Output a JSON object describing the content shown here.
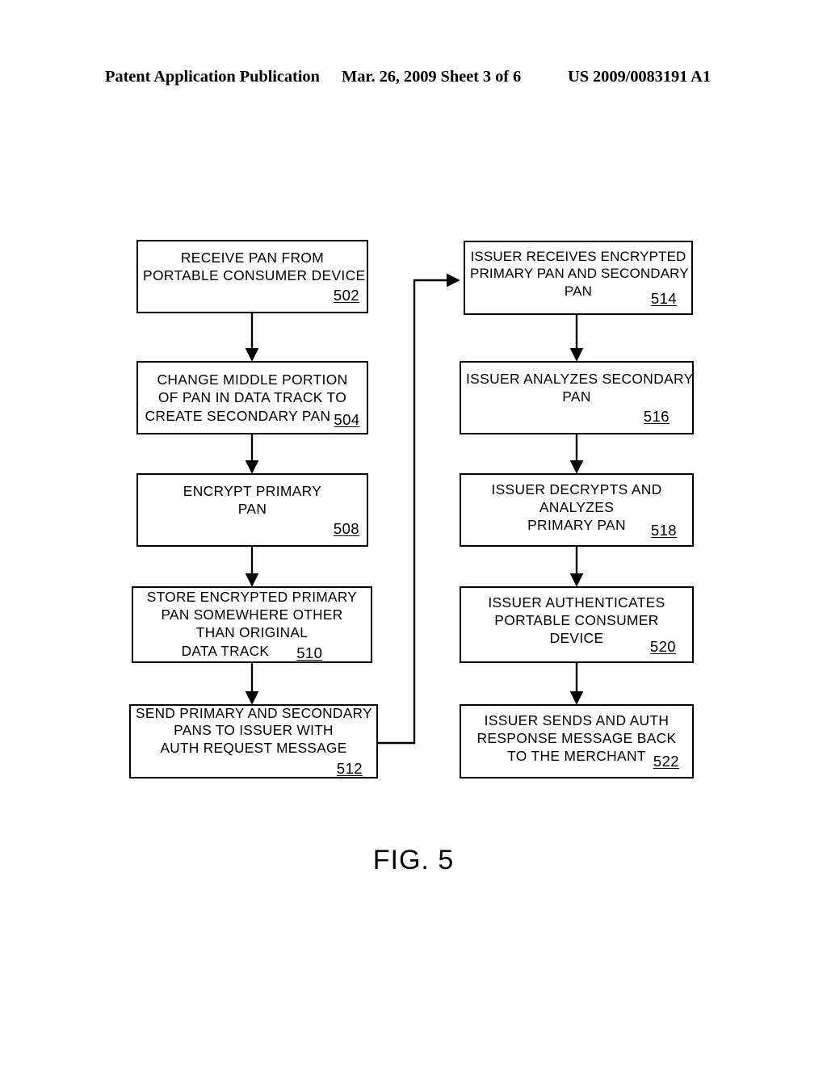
{
  "header": {
    "publication": "Patent Application Publication",
    "date_sheet": "Mar. 26, 2009  Sheet 3 of 6",
    "patent_number": "US 2009/0083191 A1"
  },
  "figure": {
    "caption": "FIG. 5",
    "type": "flowchart"
  },
  "flowchart": {
    "left_column": [
      {
        "ref": "502",
        "ref_placement": "below-right",
        "lines": [
          "RECEIVE PAN FROM",
          "PORTABLE CONSUMER DEVICE"
        ]
      },
      {
        "ref": "504",
        "ref_placement": "inline-end",
        "lines": [
          "CHANGE MIDDLE PORTION",
          "OF PAN IN DATA TRACK TO",
          "CREATE SECONDARY PAN"
        ]
      },
      {
        "ref": "508",
        "ref_placement": "below-right",
        "lines": [
          "ENCRYPT PRIMARY",
          "PAN"
        ]
      },
      {
        "ref": "510",
        "ref_placement": "inline-end",
        "lines": [
          "STORE ENCRYPTED PRIMARY",
          "PAN SOMEWHERE OTHER",
          "THAN ORIGINAL",
          "DATA TRACK"
        ]
      },
      {
        "ref": "512",
        "ref_placement": "below-right",
        "lines": [
          "SEND PRIMARY AND SECONDARY",
          "PANS TO ISSUER WITH",
          "AUTH REQUEST MESSAGE"
        ]
      }
    ],
    "right_column": [
      {
        "ref": "514",
        "ref_placement": "below-right",
        "lines": [
          "ISSUER RECEIVES ENCRYPTED",
          "PRIMARY PAN AND SECONDARY",
          "PAN"
        ]
      },
      {
        "ref": "516",
        "ref_placement": "below-right",
        "lines": [
          "ISSUER ANALYZES SECONDARY",
          "PAN"
        ]
      },
      {
        "ref": "518",
        "ref_placement": "below-right",
        "lines": [
          "ISSUER DECRYPTS AND",
          "ANALYZES",
          "PRIMARY PAN"
        ]
      },
      {
        "ref": "520",
        "ref_placement": "below-right",
        "lines": [
          "ISSUER AUTHENTICATES",
          "PORTABLE CONSUMER",
          "DEVICE"
        ]
      },
      {
        "ref": "522",
        "ref_placement": "below-right",
        "lines": [
          "ISSUER SENDS AND AUTH",
          "RESPONSE MESSAGE BACK",
          "TO THE MERCHANT"
        ]
      }
    ],
    "connectors": [
      {
        "from": "502",
        "to": "504",
        "style": "vertical-arrow"
      },
      {
        "from": "504",
        "to": "508",
        "style": "vertical-arrow"
      },
      {
        "from": "508",
        "to": "510",
        "style": "vertical-arrow"
      },
      {
        "from": "510",
        "to": "512",
        "style": "vertical-arrow"
      },
      {
        "from": "512",
        "to": "514",
        "style": "right-up-right-arrow"
      },
      {
        "from": "514",
        "to": "516",
        "style": "vertical-arrow"
      },
      {
        "from": "516",
        "to": "518",
        "style": "vertical-arrow"
      },
      {
        "from": "518",
        "to": "520",
        "style": "vertical-arrow"
      },
      {
        "from": "520",
        "to": "522",
        "style": "vertical-arrow"
      }
    ]
  },
  "colors": {
    "ink": "#000000",
    "paper": "#ffffff"
  }
}
